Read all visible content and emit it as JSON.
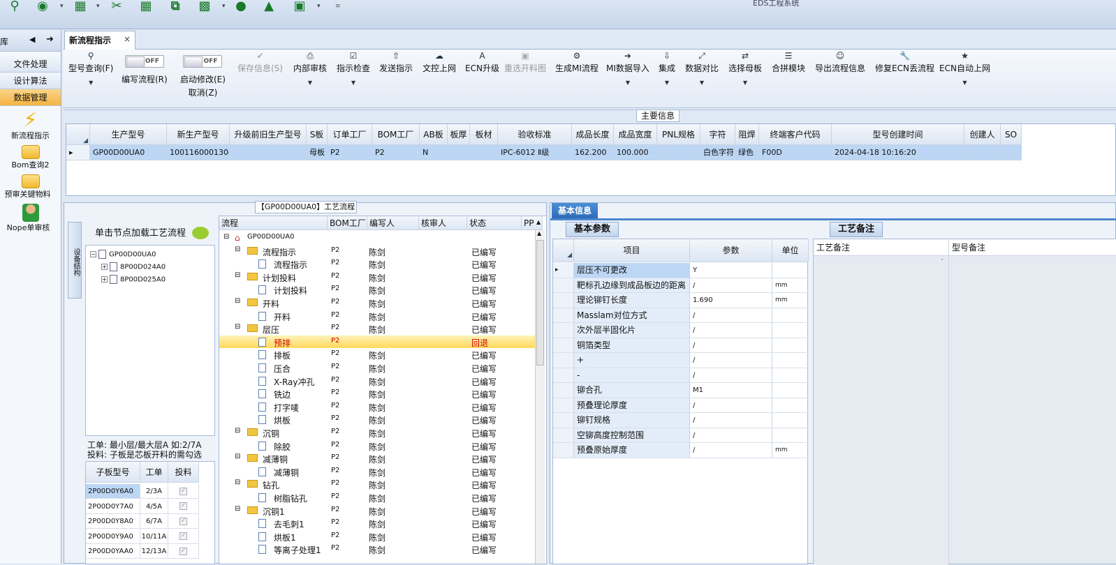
{
  "app_title": "EDS工程系统",
  "left_nav": {
    "header": "库",
    "buttons": [
      "文件处理",
      "设计算法",
      "数据管理"
    ],
    "active_button": "数据管理",
    "items": [
      {
        "label": "新流程指示",
        "icon": "lightning-icon"
      },
      {
        "label": "Bom查询2",
        "icon": "folder-icon"
      },
      {
        "label": "预审关键物料",
        "icon": "folder-icon"
      },
      {
        "label": "Nope单审核",
        "icon": "user-icon"
      }
    ]
  },
  "tab": {
    "label": "新流程指示",
    "close": "×"
  },
  "ribbon": {
    "type_query": "型号查询(F)",
    "edit_flow": "编写流程(R)",
    "start_modify": "启动修改(E)",
    "cancel": "取消(Z)",
    "toggle_off": "OFF",
    "save_info": "保存信息(S)",
    "internal_review": "内部审核",
    "indicator_check": "指示检查",
    "send_indicator": "发送指示",
    "doc_upload": "文控上网",
    "ecn_upgrade": "ECN升级",
    "reselect_cut": "重选开料图",
    "generate_mi": "生成MI流程",
    "mi_import": "MI数据导入",
    "integrate": "集成",
    "data_compare": "数据对比",
    "select_mother": "选择母板",
    "merge_module": "合拼模块",
    "export_flow": "导出流程信息",
    "fix_ecn": "修复ECN丢流程",
    "ecn_auto": "ECN自动上网"
  },
  "main_info": {
    "label": "主要信息",
    "columns": [
      "生产型号",
      "新生产型号",
      "升级前旧生产型号",
      "S板",
      "订单工厂",
      "BOM工厂",
      "AB板",
      "板厚",
      "板材",
      "验收标准",
      "成品长度",
      "成品宽度",
      "PNL规格",
      "字符",
      "阻焊",
      "终端客户代码",
      "型号创建时间",
      "创建人",
      "SO"
    ],
    "row": [
      "GP00D00UA0",
      "10011600013043",
      "",
      "母板",
      "P2",
      "P2",
      "N",
      "",
      "",
      "IPC-6012 Ⅱ级",
      "162.200",
      "100.000",
      "",
      "白色字符",
      "绿色",
      "F00D",
      "2024-04-18 10:16:20",
      "",
      ""
    ]
  },
  "process_panel": {
    "title": "【GP00D00UA0】工艺流程",
    "vertical_tab": "设备结构",
    "tree_header": "单击节点加载工艺流程",
    "tree": [
      {
        "label": "GP00D00UA0",
        "level": 0
      },
      {
        "label": "8P00D024A0",
        "level": 1
      },
      {
        "label": "8P00D025A0",
        "level": 1
      }
    ],
    "note_line1": "工单: 最小层/最大层A 如:2/7A",
    "note_line2": "投料: 子板是芯板开料的需勾选",
    "sub_columns": [
      "子板型号",
      "工单",
      "投料"
    ],
    "sub_rows": [
      [
        "2P00D0Y6A0",
        "2/3A"
      ],
      [
        "2P00D0Y7A0",
        "4/5A"
      ],
      [
        "2P00D0Y8A0",
        "6/7A"
      ],
      [
        "2P00D0Y9A0",
        "10/11A"
      ],
      [
        "2P00D0YAA0",
        "12/13A"
      ]
    ],
    "flow_columns": [
      "流程",
      "BOM工厂",
      "编写人",
      "核审人",
      "状态",
      "PP"
    ],
    "flow_root": "GP00D00UA0",
    "flow_rows": [
      {
        "name": "流程指示",
        "type": "folder",
        "bom": "P2",
        "writer": "陈剑",
        "status": "已编写"
      },
      {
        "name": "流程指示",
        "type": "page",
        "bom": "P2",
        "writer": "陈剑",
        "status": "已编写"
      },
      {
        "name": "计划投料",
        "type": "folder",
        "bom": "P2",
        "writer": "陈剑",
        "status": "已编写"
      },
      {
        "name": "计划投料",
        "type": "page",
        "bom": "P2",
        "writer": "陈剑",
        "status": "已编写"
      },
      {
        "name": "开料",
        "type": "folder",
        "bom": "P2",
        "writer": "陈剑",
        "status": "已编写"
      },
      {
        "name": "开料",
        "type": "page",
        "bom": "P2",
        "writer": "陈剑",
        "status": "已编写"
      },
      {
        "name": "层压",
        "type": "folder",
        "bom": "P2",
        "writer": "陈剑",
        "status": "已编写"
      },
      {
        "name": "预排",
        "type": "page",
        "bom": "P2",
        "writer": "",
        "status": "回退",
        "selected": true
      },
      {
        "name": "排板",
        "type": "page",
        "bom": "P2",
        "writer": "陈剑",
        "status": "已编写"
      },
      {
        "name": "压合",
        "type": "page",
        "bom": "P2",
        "writer": "陈剑",
        "status": "已编写"
      },
      {
        "name": "X-Ray冲孔",
        "type": "page",
        "bom": "P2",
        "writer": "陈剑",
        "status": "已编写"
      },
      {
        "name": "铣边",
        "type": "page",
        "bom": "P2",
        "writer": "陈剑",
        "status": "已编写"
      },
      {
        "name": "打字唛",
        "type": "page",
        "bom": "P2",
        "writer": "陈剑",
        "status": "已编写"
      },
      {
        "name": "烘板",
        "type": "page",
        "bom": "P2",
        "writer": "陈剑",
        "status": "已编写"
      },
      {
        "name": "沉铜",
        "type": "folder",
        "bom": "P2",
        "writer": "陈剑",
        "status": "已编写"
      },
      {
        "name": "除胶",
        "type": "page",
        "bom": "P2",
        "writer": "陈剑",
        "status": "已编写"
      },
      {
        "name": "减薄铜",
        "type": "folder",
        "bom": "P2",
        "writer": "陈剑",
        "status": "已编写"
      },
      {
        "name": "减薄铜",
        "type": "page",
        "bom": "P2",
        "writer": "陈剑",
        "status": "已编写"
      },
      {
        "name": "钻孔",
        "type": "folder",
        "bom": "P2",
        "writer": "陈剑",
        "status": "已编写"
      },
      {
        "name": "树脂钻孔",
        "type": "page",
        "bom": "P2",
        "writer": "陈剑",
        "status": "已编写"
      },
      {
        "name": "沉铜1",
        "type": "folder",
        "bom": "P2",
        "writer": "陈剑",
        "status": "已编写"
      },
      {
        "name": "去毛刺1",
        "type": "page",
        "bom": "P2",
        "writer": "陈剑",
        "status": "已编写"
      },
      {
        "name": "烘板1",
        "type": "page",
        "bom": "P2",
        "writer": "陈剑",
        "status": "已编写"
      },
      {
        "name": "等离子处理1",
        "type": "page",
        "bom": "P2",
        "writer": "陈剑",
        "status": "已编写"
      }
    ]
  },
  "basic_info": {
    "tab": "基本信息",
    "param_tab": "基本参数",
    "note_tab": "工艺备注",
    "param_columns": [
      "项目",
      "参数",
      "单位"
    ],
    "params": [
      [
        "层压不可更改",
        "Y",
        ""
      ],
      [
        "靶标孔边缘到成品板边的距离",
        "/",
        "mm"
      ],
      [
        "理论铆钉长度",
        "1.690",
        "mm"
      ],
      [
        "Masslam对位方式",
        "/",
        ""
      ],
      [
        "次外层半固化片",
        "/",
        ""
      ],
      [
        "铜箔类型",
        "/",
        ""
      ],
      [
        "+",
        "/",
        ""
      ],
      [
        "-",
        "/",
        ""
      ],
      [
        "铆合孔",
        "M1",
        ""
      ],
      [
        "预叠理论厚度",
        "/",
        ""
      ],
      [
        "铆钉规格",
        "/",
        ""
      ],
      [
        "空铆高度控制范围",
        "/",
        ""
      ],
      [
        "预叠原始厚度",
        "/",
        "mm"
      ]
    ],
    "note_columns": [
      "工艺备注",
      "型号备注"
    ]
  }
}
